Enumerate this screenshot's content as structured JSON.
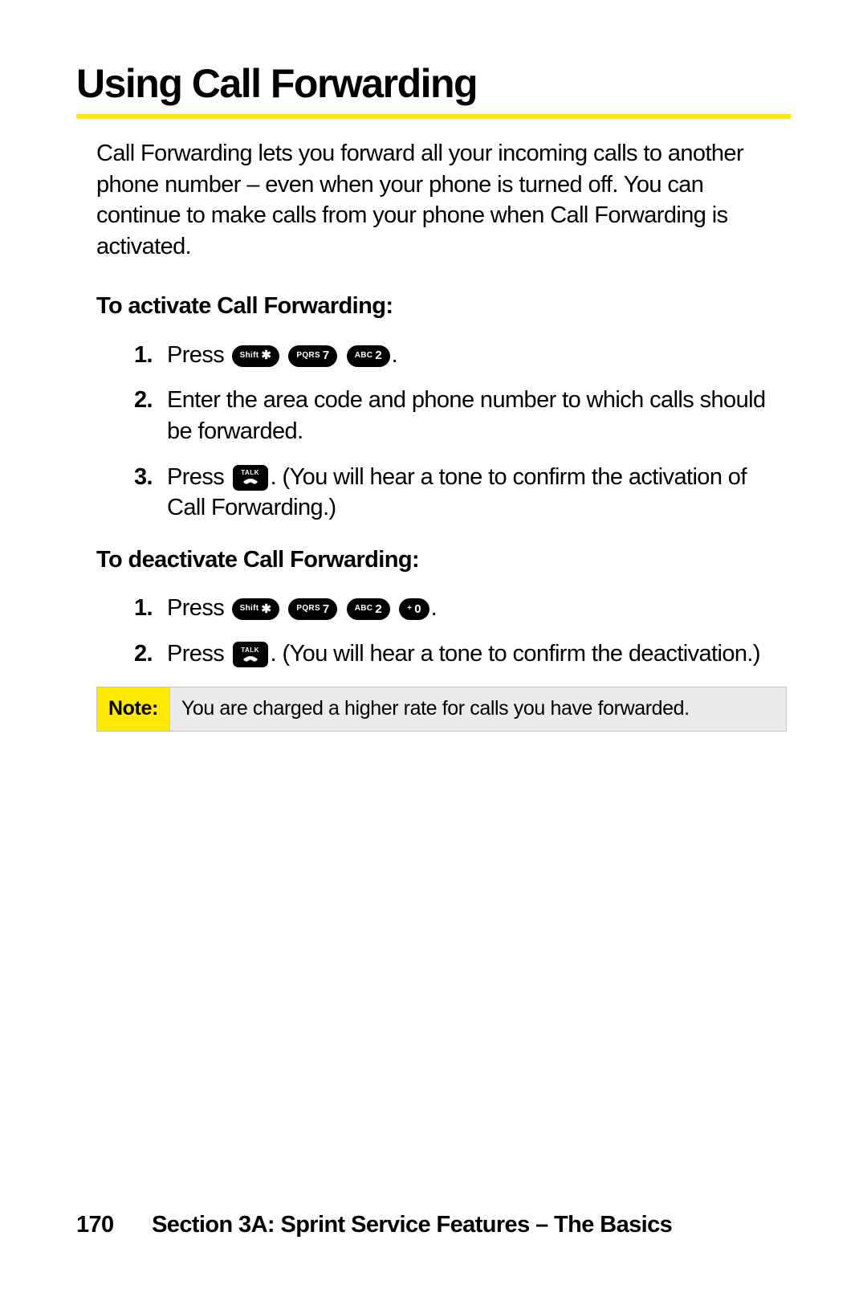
{
  "heading": "Using Call Forwarding",
  "intro": "Call Forwarding lets you forward all your incoming calls to another phone number – even when your phone is turned off. You can continue to make calls from your phone when Call Forwarding is activated.",
  "activate": {
    "subhead": "To activate Call Forwarding:",
    "steps": {
      "s1_press": "Press",
      "s1_period": ".",
      "s2": "Enter the area code and phone number to which calls should be forwarded.",
      "s3_press": "Press",
      "s3_rest": ". (You will hear a tone to confirm the activation of Call Forwarding.)"
    }
  },
  "deactivate": {
    "subhead": "To deactivate Call Forwarding:",
    "steps": {
      "s1_press": "Press",
      "s1_period": ".",
      "s2_press": "Press",
      "s2_rest": ". (You will hear a tone to confirm the deactivation.)"
    }
  },
  "keys": {
    "shift_small": "Shift",
    "shift_big": "✱",
    "pqrs_small": "PQRS",
    "pqrs_big": "7",
    "abc_small": "ABC",
    "abc_big": "2",
    "plus_small": "+",
    "plus_big": "0",
    "talk": "TALK"
  },
  "note": {
    "label": "Note:",
    "text": "You are charged a higher rate for calls you have forwarded."
  },
  "footer": {
    "page": "170",
    "section": "Section 3A: Sprint Service Features – The Basics"
  },
  "nums": {
    "n1": "1.",
    "n2": "2.",
    "n3": "3."
  }
}
